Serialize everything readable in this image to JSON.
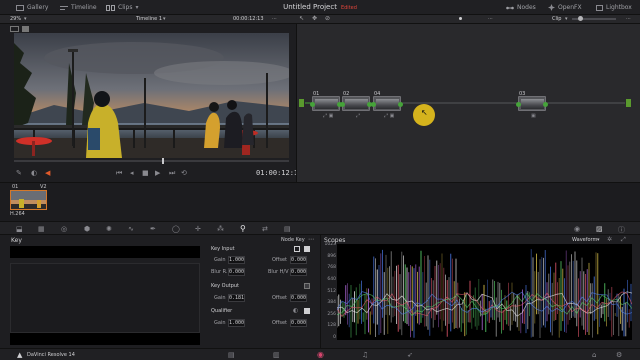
{
  "nav": {
    "gallery": "Gallery",
    "timeline": "Timeline",
    "clips": "Clips",
    "project_title": "Untitled Project",
    "project_status": "Edited",
    "nodes": "Nodes",
    "openfx": "OpenFX",
    "lightbox": "Lightbox"
  },
  "viewer": {
    "zoom": "29%",
    "timeline_name": "Timeline 1",
    "timecode_top": "00:00:12:13",
    "timecode": "01:00:12:13"
  },
  "node_editor": {
    "mode": "Clip",
    "nodes": [
      {
        "num": "01"
      },
      {
        "num": "02"
      },
      {
        "num": "04"
      },
      {
        "num": "03"
      }
    ]
  },
  "clips": {
    "items": [
      {
        "index": "01",
        "track": "V2",
        "codec": "H.264"
      }
    ]
  },
  "key_panel": {
    "title": "Key",
    "node_key_label": "Node Key",
    "key_input": {
      "label": "Key Input",
      "gain_label": "Gain",
      "gain": "1.000",
      "offset_label": "Offset",
      "offset": "0.000",
      "blur_r_label": "Blur R.",
      "blur_r": "0.000",
      "blur_hv_label": "Blur H/V",
      "blur_hv": "0.000"
    },
    "key_output": {
      "label": "Key Output",
      "gain_label": "Gain",
      "gain": "0.181",
      "offset_label": "Offset",
      "offset": "0.000"
    },
    "qualifier": {
      "label": "Qualifier",
      "gain_label": "Gain",
      "gain": "1.000",
      "offset_label": "Offset",
      "offset": "0.000"
    }
  },
  "scopes": {
    "title": "Scopes",
    "mode": "Waveform",
    "scale": [
      "1023",
      "896",
      "768",
      "640",
      "512",
      "384",
      "256",
      "128",
      "0"
    ]
  },
  "bottom": {
    "app_name": "DaVinci Resolve 14"
  },
  "colors": {
    "accent_orange": "#d4782a",
    "node_connector": "#46a33a",
    "edited_red": "#e0453a"
  }
}
